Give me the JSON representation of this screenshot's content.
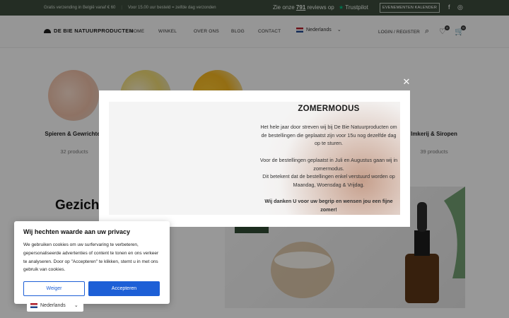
{
  "topbar": {
    "shipping_text": "Gratis verzending in België vanaf € 60",
    "delivery_text": "Voor 15.00 uur besteld = zelfde dag verzonden",
    "reviews_prefix": "Zie onze",
    "reviews_count": "791",
    "reviews_middle": "reviews op",
    "reviews_brand": "Trustpilot",
    "events_button": "EVENEMENTEN KALENDER"
  },
  "header": {
    "logo": "DE BIE NATUURPRODUCTEN",
    "nav": [
      "HOME",
      "WINKEL",
      "OVER ONS",
      "BLOG",
      "CONTACT"
    ],
    "language": "Nederlands",
    "login": "LOGIN / REGISTER",
    "wishlist_count": "0",
    "cart_count": "0"
  },
  "categories": [
    {
      "name": "Spieren & Gewrichten",
      "count": "32 products"
    },
    {
      "name": "Imkerij & Siropen",
      "count": "39 products"
    }
  ],
  "section_title": "Gezich",
  "modal": {
    "title": "ZOMERMODUS",
    "p1": "Het hele jaar door streven wij bij De Bie Natuurproducten om de bestellingen die geplaatst zijn voor 15u nog dezelfde dag op te sturen.",
    "p2": "Voor de bestellingen geplaatst in Juli en Augustus gaan wij in zomermodus.",
    "p3": "Dit betekent dat de bestellingen enkel verstuurd worden op Maandag, Woensdag & Vrijdag.",
    "p4": "Wij danken U voor uw begrip en wensen jou een fijne zomer!"
  },
  "privacy": {
    "title": "Wij hechten waarde aan uw privacy",
    "body": "We gebruiken cookies om uw surfervaring te verbeteren, gepersonaliseerde advertenties of content te tonen en ons verkeer te analyseren. Door op \"Accepteren\" te klikken, stemt u in met ons gebruik van cookies.",
    "deny": "Weiger",
    "accept": "Accepteren"
  },
  "lang_switcher": "Nederlands"
}
